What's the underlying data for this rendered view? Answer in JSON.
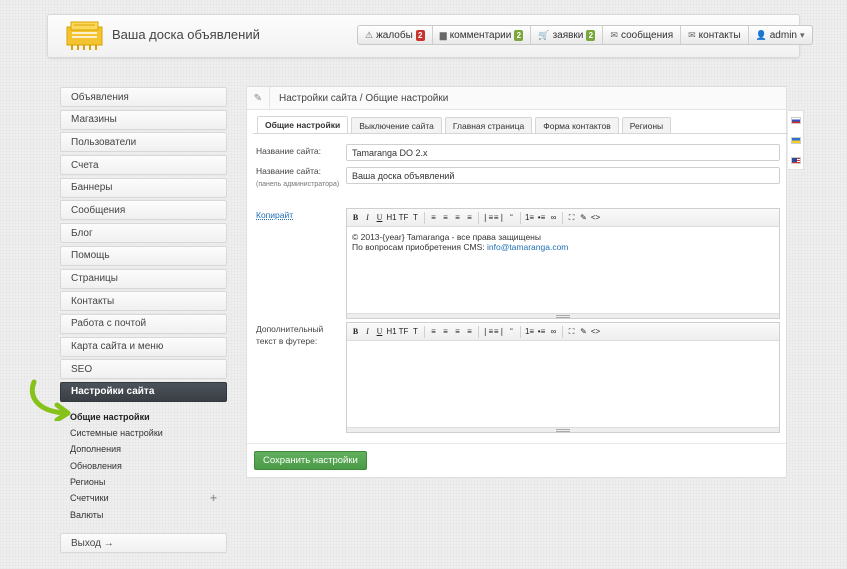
{
  "header": {
    "site_title": "Ваша доска объявлений",
    "nav": [
      {
        "label": "жалобы",
        "badge": "2",
        "badge_color": "#c8342b"
      },
      {
        "label": "комментарии",
        "badge": "2",
        "badge_color": "#7aa63b"
      },
      {
        "label": "заявки",
        "badge": "2",
        "badge_color": "#7aa63b"
      },
      {
        "label": "сообщения"
      },
      {
        "label": "контакты"
      },
      {
        "label": "admin"
      }
    ]
  },
  "sidebar": {
    "items": [
      "Объявления",
      "Магазины",
      "Пользователи",
      "Счета",
      "Баннеры",
      "Сообщения",
      "Блог",
      "Помощь",
      "Страницы",
      "Контакты",
      "Работа с почтой",
      "Карта сайта и меню",
      "SEO"
    ],
    "active": "Настройки сайта",
    "sub_items": [
      "Общие настройки",
      "Системные настройки",
      "Дополнения",
      "Обновления",
      "Регионы",
      "Счетчики",
      "Валюты"
    ],
    "sub_plus": "+",
    "logout": "Выход →"
  },
  "main": {
    "breadcrumb": "Настройки сайта / Общие настройки",
    "tabs": [
      "Общие настройки",
      "Выключение сайта",
      "Главная страница",
      "Форма контактов",
      "Регионы"
    ],
    "fields": {
      "site_name_label": "Название сайта:",
      "site_name_value": "Tamaranga DO 2.x",
      "site_name_admin_label": "Название сайта:",
      "site_name_admin_hint": "(панель администратора)",
      "site_name_admin_value": "Ваша доска объявлений",
      "copyright_label": "Копирайт",
      "copyright_line1": "© 2013-{year} Tamaranga - все права защищены",
      "copyright_line2_prefix": "По вопросам приобретения CMS: ",
      "copyright_email": "info@tamaranga.com",
      "footer_text_label": "Дополнительный текст в футере:"
    },
    "toolbar": [
      "B",
      "I",
      "U",
      "H1",
      "TF",
      "T",
      "≡",
      "≡",
      "≡",
      "≡",
      "❘≡",
      "≡❘",
      "“",
      "1≡",
      "•≡",
      "∞",
      "⛶",
      "✎",
      "<>"
    ],
    "save_label": "Сохранить настройки"
  },
  "colors": {
    "accent": "#4a9a46",
    "active_sidebar": "#3f444a",
    "link": "#1f6fb5"
  }
}
